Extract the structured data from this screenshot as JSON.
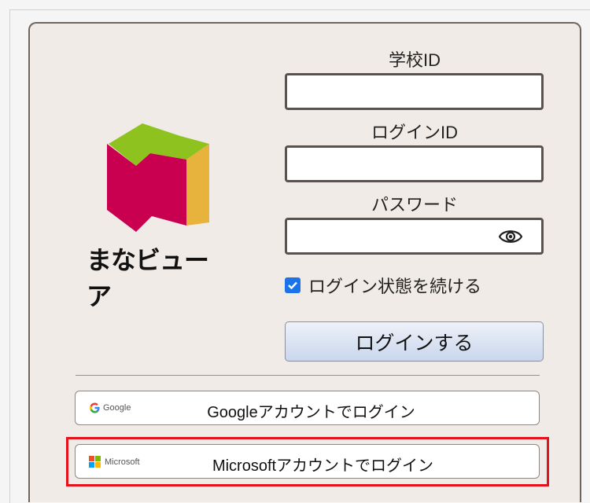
{
  "app": {
    "logo_text": "まなビューア"
  },
  "form": {
    "school_id_label": "学校ID",
    "login_id_label": "ログインID",
    "password_label": "パスワード",
    "school_id_value": "",
    "login_id_value": "",
    "password_value": "",
    "remember_label": "ログイン状態を続ける",
    "remember_checked": true,
    "login_button": "ログインする"
  },
  "sso": {
    "google": {
      "brand": "Google",
      "label": "Googleアカウントでログイン"
    },
    "microsoft": {
      "brand": "Microsoft",
      "label": "Microsoftアカウントでログイン"
    }
  },
  "colors": {
    "panel_bg": "#f0ebe6",
    "checkbox": "#1a73e8",
    "highlight": "#e3121b",
    "logo_green": "#8dc21f",
    "logo_red": "#c8004f",
    "logo_yellow": "#e8b33c"
  },
  "icons": [
    "eye-icon",
    "check-icon",
    "google-logo-icon",
    "microsoft-logo-icon",
    "manaviewer-book-icon"
  ]
}
